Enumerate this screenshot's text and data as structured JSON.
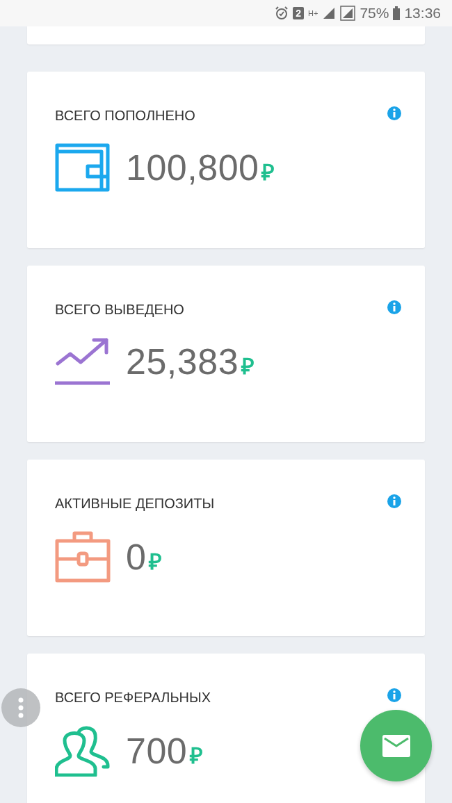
{
  "status_bar": {
    "sim_badge": "2",
    "network": "H+",
    "battery": "75%",
    "time": "13:36"
  },
  "cards": [
    {
      "kind": "wallet",
      "color": "#1ba8ee",
      "title": "ВСЕГО ПОПОЛНЕНО",
      "amount": "100,800",
      "currency": "₽"
    },
    {
      "kind": "trend",
      "color": "#9b74d2",
      "title": "ВСЕГО ВЫВЕДЕНО",
      "amount": "25,383",
      "currency": "₽"
    },
    {
      "kind": "briefcase",
      "color": "#f39a80",
      "title": "АКТИВНЫЕ ДЕПОЗИТЫ",
      "amount": "0",
      "currency": "₽"
    },
    {
      "kind": "users",
      "color": "#1fbf8f",
      "title": "ВСЕГО РЕФЕРАЛЬНЫХ",
      "amount": "700",
      "currency": "₽"
    }
  ]
}
